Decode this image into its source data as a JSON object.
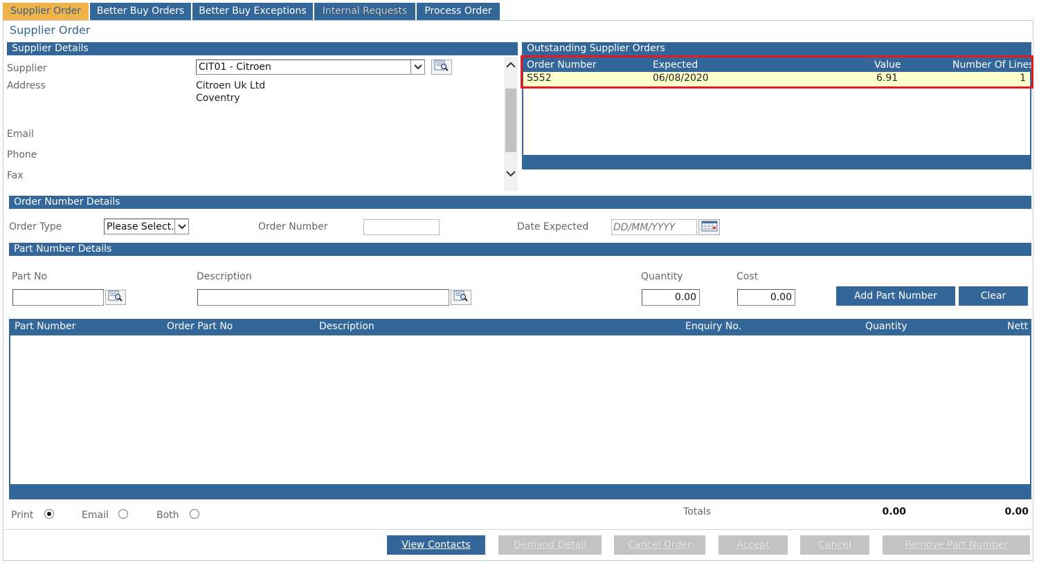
{
  "tabs": [
    {
      "label": "Supplier Order"
    },
    {
      "label": "Better Buy Orders"
    },
    {
      "label": "Better Buy Exceptions"
    },
    {
      "label": "Internal Requests"
    },
    {
      "label": "Process Order"
    }
  ],
  "page_title": "Supplier Order",
  "supplier_details": {
    "header": "Supplier Details",
    "supplier_label": "Supplier",
    "supplier_value": "CIT01 - Citroen",
    "address_label": "Address",
    "address_line1": "Citroen Uk Ltd",
    "address_line2": "Coventry",
    "email_label": "Email",
    "phone_label": "Phone",
    "fax_label": "Fax"
  },
  "outstanding": {
    "header": "Outstanding Supplier Orders",
    "columns": [
      "Order Number",
      "Expected",
      "Value",
      "Number Of Lines"
    ],
    "rows": [
      {
        "order_number": "S552",
        "expected": "06/08/2020",
        "value": "6.91",
        "lines": "1"
      }
    ]
  },
  "order_number_details": {
    "header": "Order Number Details",
    "order_type_label": "Order Type",
    "order_type_value": "Please Select.",
    "order_number_label": "Order Number",
    "order_number_value": "",
    "date_expected_label": "Date Expected",
    "date_expected_placeholder": "DD/MM/YYYY"
  },
  "part_number_details": {
    "header": "Part Number Details",
    "part_no_label": "Part No",
    "description_label": "Description",
    "quantity_label": "Quantity",
    "quantity_value": "0.00",
    "cost_label": "Cost",
    "cost_value": "0.00",
    "add_button": "Add Part Number",
    "clear_button": "Clear"
  },
  "parts_grid": {
    "columns": [
      "Part Number",
      "Order Part No",
      "Description",
      "Enquiry No.",
      "Quantity",
      "Nett"
    ]
  },
  "output": {
    "print_label": "Print",
    "email_label": "Email",
    "both_label": "Both",
    "selected": "Print"
  },
  "totals": {
    "label": "Totals",
    "quantity": "0.00",
    "nett": "0.00"
  },
  "footer_buttons": {
    "view_contacts": "View Contacts",
    "demand_detail": "Demand Detail",
    "cancel_order": "Cancel Order",
    "accept": "Accept",
    "cancel": "Cancel",
    "remove_part_number": "Remove Part Number"
  },
  "colors": {
    "accent": "#336699",
    "active_tab": "#f0b34a",
    "highlight_row": "#ffffcc",
    "annotation": "#e8191c"
  }
}
